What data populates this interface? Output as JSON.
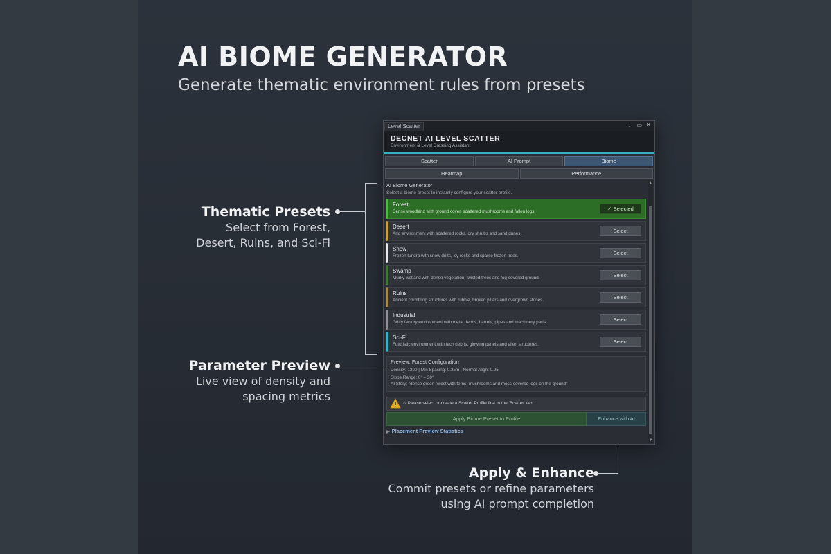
{
  "hero": {
    "title": "AI BIOME GENERATOR",
    "subtitle": "Generate thematic environment rules from presets"
  },
  "callouts": [
    {
      "title": "Thematic Presets",
      "lines": [
        "Select from Forest,",
        "Desert, Ruins, and Sci-Fi"
      ]
    },
    {
      "title": "Parameter Preview",
      "lines": [
        "Live view of density and",
        "spacing metrics"
      ]
    },
    {
      "title": "Apply & Enhance",
      "lines": [
        "Commit presets or refine parameters",
        "using AI prompt completion"
      ]
    }
  ],
  "window": {
    "tab_label": "Level Scatter",
    "controls": "⋮ ▭ ✕",
    "header_title": "DECNET AI LEVEL SCATTER",
    "header_subtitle": "Environment & Level Dressing Assistant",
    "tabs_row1": [
      "Scatter",
      "AI Prompt",
      "Biome"
    ],
    "tabs_row2": [
      "Heatmap",
      "Performance"
    ],
    "active_tab": "Biome",
    "section_title": "AI Biome Generator",
    "section_desc": "Select a biome preset to instantly configure your scatter profile.",
    "presets": [
      {
        "name": "Forest",
        "desc": "Dense woodland with ground cover, scattered mushrooms and fallen logs.",
        "button": "✓ Selected",
        "selected": true,
        "accent": "#4fb843"
      },
      {
        "name": "Desert",
        "desc": "Arid environment with scattered rocks, dry shrubs and sand dunes.",
        "button": "Select",
        "selected": false,
        "accent": "#c9a23a"
      },
      {
        "name": "Snow",
        "desc": "Frozen tundra with snow drifts, icy rocks and sparse frozen trees.",
        "button": "Select",
        "selected": false,
        "accent": "#e6e9ec"
      },
      {
        "name": "Swamp",
        "desc": "Murky wetland with dense vegetation, twisted trees and fog-covered ground.",
        "button": "Select",
        "selected": false,
        "accent": "#3f7a36"
      },
      {
        "name": "Ruins",
        "desc": "Ancient crumbling structures with rubble, broken pillars and overgrown stones.",
        "button": "Select",
        "selected": false,
        "accent": "#a8884c"
      },
      {
        "name": "Industrial",
        "desc": "Gritty factory environment with metal debris, barrels, pipes and machinery parts.",
        "button": "Select",
        "selected": false,
        "accent": "#8d9096"
      },
      {
        "name": "Sci-Fi",
        "desc": "Futuristic environment with tech debris, glowing panels and alien structures.",
        "button": "Select",
        "selected": false,
        "accent": "#35b3c4"
      }
    ],
    "preview": {
      "title": "Preview: Forest Configuration",
      "stats": "Density: 1200   |   Min Spacing: 0.35m   |   Normal Align: 0.95",
      "slope": "Slope Range: 0° – 30°",
      "ai_story": "AI Story: \"dense green forest with ferns, mushrooms and moss-covered logs on the ground\""
    },
    "warning": "⚠ Please select or create a Scatter Profile first in the 'Scatter' tab.",
    "apply_button": "Apply Biome Preset to Profile",
    "enhance_button": "Enhance with AI",
    "foldout": "Placement Preview Statistics"
  },
  "colors": {
    "accent_cyan": "#35b3c4",
    "selected_green": "#2c6e25",
    "active_tab_blue": "#3d5674",
    "warning_yellow": "#e3b021"
  }
}
